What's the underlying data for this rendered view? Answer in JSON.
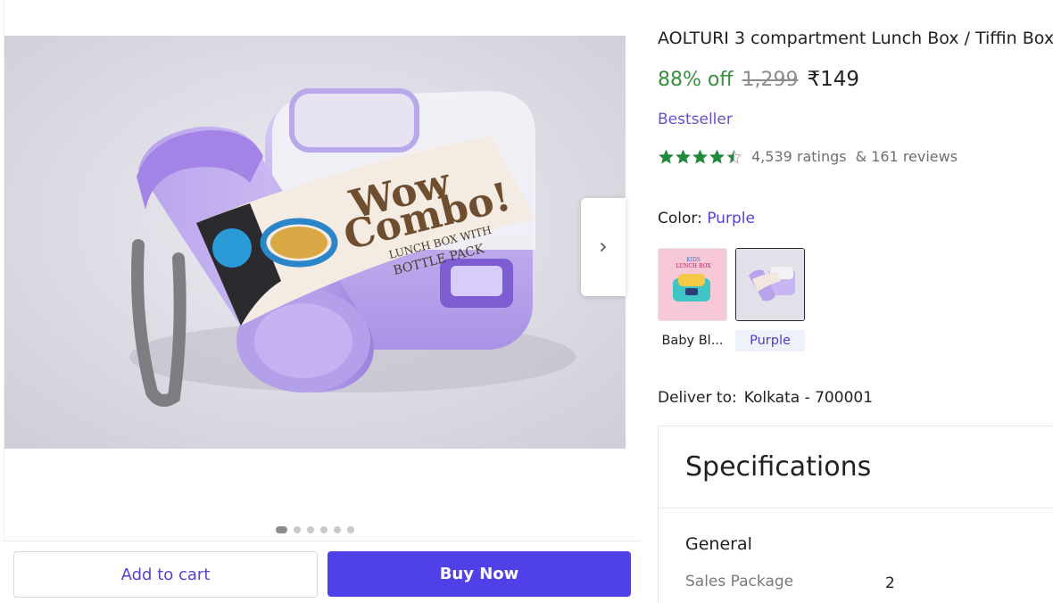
{
  "product": {
    "title": "AOLTURI 3 compartment Lunch Box / Tiffin Box",
    "discount": "88% off",
    "mrp": "1,299",
    "price": "₹149",
    "badge": "Bestseller",
    "rating_value": 4.5,
    "ratings_text": "4,539 ratings",
    "reviews_text": "& 161 reviews",
    "packaging_text": [
      "Wow",
      "Combo!",
      "LUNCH BOX WITH",
      "BOTTLE PACK"
    ],
    "colors": {
      "accent": "#5040e8",
      "discount_green": "#388e3c",
      "star_green": "#1f8a3a"
    }
  },
  "gallery": {
    "dots_total": 6,
    "active_index": 0,
    "next_icon": "chevron-right-icon"
  },
  "color_select": {
    "label": "Color:",
    "selected": "Purple",
    "options": [
      {
        "label": "Baby Bl...",
        "selected": false,
        "thumb_text": [
          "KIDS",
          "LUNCH BOX"
        ]
      },
      {
        "label": "Purple",
        "selected": true
      }
    ]
  },
  "delivery": {
    "label": "Deliver to:",
    "location": "Kolkata - 700001"
  },
  "specifications": {
    "heading": "Specifications",
    "group": "General",
    "rows": [
      {
        "key": "Sales Package",
        "value": "2"
      }
    ]
  },
  "actions": {
    "add_to_cart": "Add to cart",
    "buy_now": "Buy Now"
  }
}
